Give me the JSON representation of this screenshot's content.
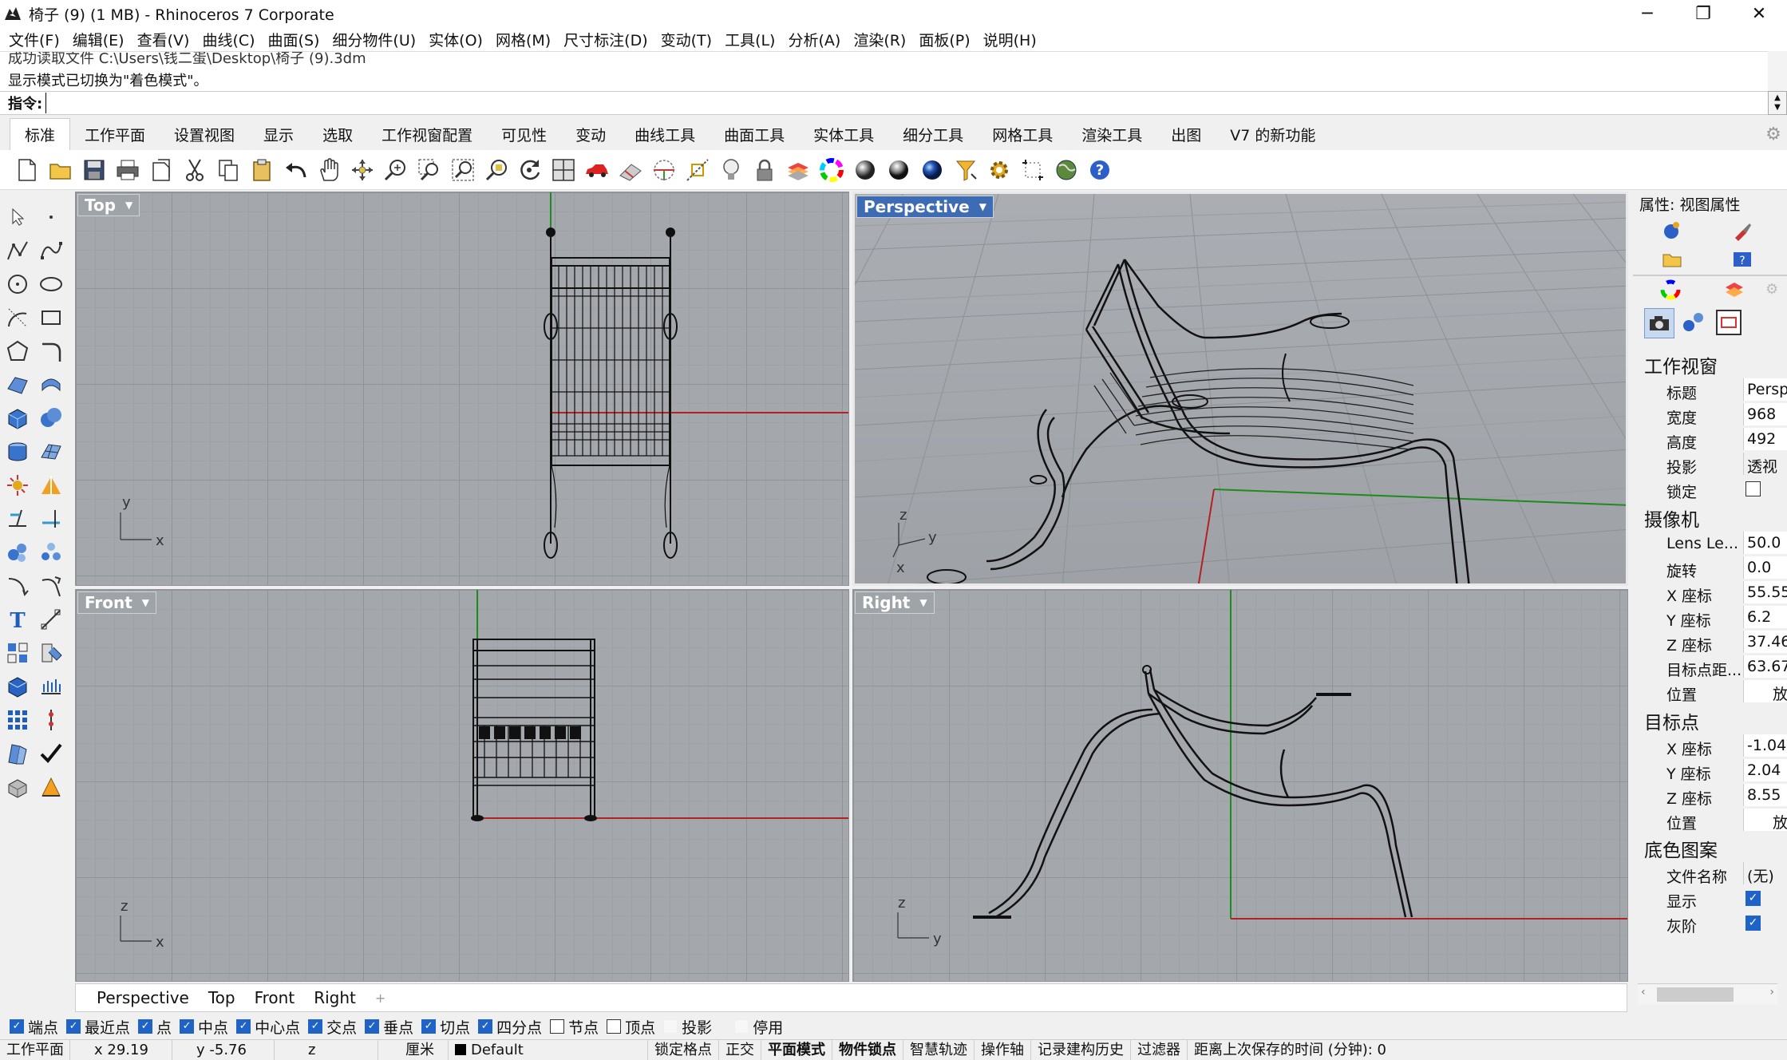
{
  "window": {
    "title": "椅子 (9) (1 MB) - Rhinoceros 7 Corporate",
    "minimize": "─",
    "maximize": "❐",
    "close": "✕"
  },
  "menu": [
    "文件(F)",
    "编辑(E)",
    "查看(V)",
    "曲线(C)",
    "曲面(S)",
    "细分物件(U)",
    "实体(O)",
    "网格(M)",
    "尺寸标注(D)",
    "变动(T)",
    "工具(L)",
    "分析(A)",
    "渲染(R)",
    "面板(P)",
    "说明(H)"
  ],
  "history": {
    "line1": "成功读取文件 C:\\Users\\钱二蛋\\Desktop\\椅子 (9).3dm",
    "line2": "显示模式已切换为\"着色模式\"。"
  },
  "command": {
    "label": "指令:",
    "value": ""
  },
  "tabs": [
    "标准",
    "工作平面",
    "设置视图",
    "显示",
    "选取",
    "工作视窗配置",
    "可见性",
    "变动",
    "曲线工具",
    "曲面工具",
    "实体工具",
    "细分工具",
    "网格工具",
    "渲染工具",
    "出图",
    "V7 的新功能"
  ],
  "active_tab": "标准",
  "toolbar_icons": [
    "new-file-icon",
    "open-file-icon",
    "save-icon",
    "print-icon",
    "import-icon",
    "cut-icon",
    "copy-icon",
    "paste-icon",
    "undo-icon",
    "pan-hand-icon",
    "rotate-view-icon",
    "zoom-icon",
    "zoom-window-icon",
    "zoom-extents-icon",
    "zoom-selected-icon",
    "rotate-icon",
    "four-view-icon",
    "car-icon",
    "layout-icon",
    "cplane-icon",
    "osnap-icon",
    "light-bulb-icon",
    "lock-icon",
    "layer-icon",
    "color-wheel-icon",
    "shaded-sphere-icon",
    "rendered-sphere-icon",
    "render-sphere-icon",
    "filter-icon",
    "gear-options-icon",
    "grid-snap-icon",
    "globe-icon",
    "help-icon"
  ],
  "viewports": {
    "top": {
      "label": "Top",
      "axis_a": "y",
      "axis_b": "x"
    },
    "perspective": {
      "label": "Perspective",
      "axis_a": "z",
      "axis_b": "y",
      "axis_c": "x"
    },
    "front": {
      "label": "Front",
      "axis_a": "z",
      "axis_b": "x"
    },
    "right": {
      "label": "Right",
      "axis_a": "z",
      "axis_b": "y"
    }
  },
  "viewport_tabs": [
    "Perspective",
    "Top",
    "Front",
    "Right"
  ],
  "viewport_tab_add": "+",
  "properties": {
    "title": "属性: 视图属性",
    "section_viewport": "工作视窗",
    "viewport_rows": [
      {
        "k": "标题",
        "v": "Persp"
      },
      {
        "k": "宽度",
        "v": "968"
      },
      {
        "k": "高度",
        "v": "492"
      },
      {
        "k": "投影",
        "v": "透视"
      }
    ],
    "lock_label": "锁定",
    "section_camera": "摄像机",
    "camera_rows": [
      {
        "k": "Lens Le...",
        "v": "50.0"
      },
      {
        "k": "旋转",
        "v": "0.0"
      },
      {
        "k": "X 座标",
        "v": "55.55"
      },
      {
        "k": "Y 座标",
        "v": "6.2"
      },
      {
        "k": "Z 座标",
        "v": "37.46"
      },
      {
        "k": "目标点距...",
        "v": "63.67"
      },
      {
        "k": "位置",
        "v": "放"
      }
    ],
    "section_target": "目标点",
    "target_rows": [
      {
        "k": "X 座标",
        "v": "-1.04"
      },
      {
        "k": "Y 座标",
        "v": "2.04"
      },
      {
        "k": "Z 座标",
        "v": "8.55"
      },
      {
        "k": "位置",
        "v": "放"
      }
    ],
    "section_wallpaper": "底色图案",
    "wallpaper_file_label": "文件名称",
    "wallpaper_file_value": "(无)",
    "show_label": "显示",
    "gray_label": "灰阶"
  },
  "osnaps": [
    {
      "label": "端点",
      "on": true
    },
    {
      "label": "最近点",
      "on": true
    },
    {
      "label": "点",
      "on": true
    },
    {
      "label": "中点",
      "on": true
    },
    {
      "label": "中心点",
      "on": true
    },
    {
      "label": "交点",
      "on": true
    },
    {
      "label": "垂点",
      "on": true
    },
    {
      "label": "切点",
      "on": true
    },
    {
      "label": "四分点",
      "on": true
    },
    {
      "label": "节点",
      "on": false
    },
    {
      "label": "顶点",
      "on": false
    },
    {
      "label": "投影",
      "on": false
    },
    {
      "label": "停用",
      "on": false
    }
  ],
  "status": {
    "cplane": "工作平面",
    "x": "x 29.19",
    "y": "y -5.76",
    "z": "z",
    "units": "厘米",
    "layer": "Default",
    "grid_snap": "锁定格点",
    "ortho": "正交",
    "planar": "平面模式",
    "osnap": "物件锁点",
    "smarttrack": "智慧轨迹",
    "gumball": "操作轴",
    "history": "记录建构历史",
    "filter": "过滤器",
    "save_time": "距离上次保存的时间 (分钟): 0"
  },
  "colors": {
    "viewport_bg": "#a4a8ad",
    "grid_minor": "#9a9ea3",
    "grid_major": "#8d9196",
    "x_axis": "#b22222",
    "y_axis": "#1f8a1f",
    "active_label": "#3d6cb5",
    "checkbox": "#1f63c8"
  }
}
